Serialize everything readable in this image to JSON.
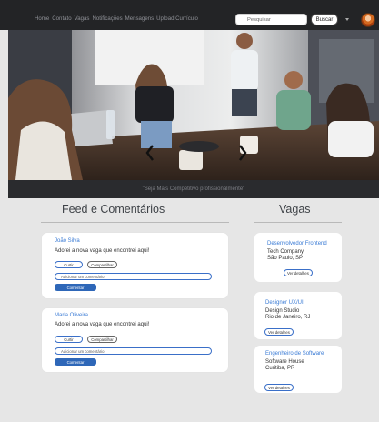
{
  "nav": {
    "links": [
      "Home",
      "Contato",
      "Vagas",
      "Notificações",
      "Mensagens",
      "Upload Currículo"
    ],
    "search_placeholder": "Pesquisar",
    "search_button": "Buscar"
  },
  "hero": {
    "caption": "\"Seja Mais Competitivo profissionalmente\""
  },
  "feed": {
    "title": "Feed e Comentários",
    "posts": [
      {
        "author": "João Silva",
        "text": "Adorei a nova vaga que encontrei aqui!",
        "like_label": "Curtir",
        "share_label": "Compartilhar",
        "comment_placeholder": "Adicionar um comentário",
        "comment_button": "Comentar"
      },
      {
        "author": "Maria Oliveira",
        "text": "Adorei a nova vaga que encontrei aqui!",
        "like_label": "Curtir",
        "share_label": "Compartilhar",
        "comment_placeholder": "Adicionar um comentário",
        "comment_button": "Comentar"
      }
    ]
  },
  "jobs": {
    "title": "Vagas",
    "items": [
      {
        "title": "Desenvolvedor Frontend",
        "company": "Tech Company",
        "location": "São Paulo, SP",
        "button": "Ver detalhes"
      },
      {
        "title": "Designer UX/UI",
        "company": "Design Studio",
        "location": "Rio de Janeiro, RJ",
        "button": "Ver detalhes"
      },
      {
        "title": "Engenheiro de Software",
        "company": "Software House",
        "location": "Curitiba, PR",
        "button": "Ver detalhes"
      }
    ]
  },
  "colors": {
    "link_blue": "#3a7bd5",
    "button_blue": "#2e67b8",
    "nav_bg": "#232426",
    "page_bg": "#e6e6e6"
  }
}
